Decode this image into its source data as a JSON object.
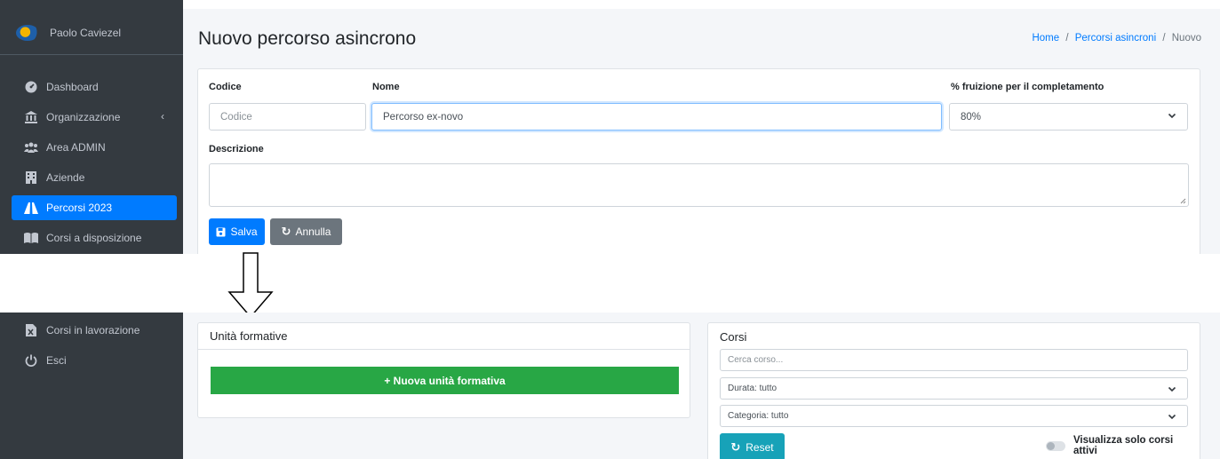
{
  "user": {
    "name": "Paolo Caviezel"
  },
  "sidebar": {
    "items": [
      {
        "label": "Dashboard",
        "icon": "dashboard-icon"
      },
      {
        "label": "Organizzazione",
        "icon": "bank-icon"
      },
      {
        "label": "Area ADMIN",
        "icon": "users-icon"
      },
      {
        "label": "Aziende",
        "icon": "building-icon"
      },
      {
        "label": "Percorsi 2023",
        "icon": "road-icon",
        "active": true
      },
      {
        "label": "Corsi a disposizione",
        "icon": "book-icon"
      },
      {
        "label": "Corsi in lavorazione",
        "icon": "file-excel-icon"
      },
      {
        "label": "Esci",
        "icon": "power-icon"
      }
    ]
  },
  "header": {
    "title": "Nuovo percorso asincrono",
    "breadcrumb": {
      "home": "Home",
      "sep": "/",
      "section": "Percorsi asincroni",
      "current": "Nuovo"
    }
  },
  "form": {
    "codice_label": "Codice",
    "codice_placeholder": "Codice",
    "nome_label": "Nome",
    "nome_value": "Percorso ex-novo",
    "fruizione_label": "% fruizione per il completamento",
    "fruizione_value": "80%",
    "descrizione_label": "Descrizione",
    "save_label": "Salva",
    "cancel_label": "Annulla"
  },
  "units": {
    "title": "Unità formative",
    "new_button": "+ Nuova unità formativa"
  },
  "courses": {
    "title": "Corsi",
    "search_placeholder": "Cerca corso...",
    "durata_value": "Durata: tutto",
    "categoria_value": "Categoria: tutto",
    "reset_label": "Reset",
    "toggle_label": "Visualizza solo corsi attivi"
  },
  "colors": {
    "sidebar_bg": "#343a40",
    "primary": "#007bff",
    "secondary": "#6c757d",
    "success": "#28a745",
    "info": "#17a2b8"
  }
}
